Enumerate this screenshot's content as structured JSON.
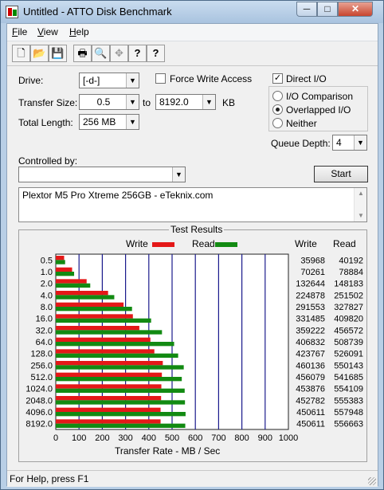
{
  "window": {
    "title": "Untitled - ATTO Disk Benchmark",
    "min_label": "─",
    "max_label": "□",
    "close_label": "✕"
  },
  "menu": [
    {
      "label": "File",
      "key": "F",
      "rest": "ile"
    },
    {
      "label": "View",
      "key": "V",
      "rest": "iew"
    },
    {
      "label": "Help",
      "key": "H",
      "rest": "elp"
    }
  ],
  "toolbar": {
    "icons": [
      "new-file-icon",
      "open-folder-icon",
      "save-icon",
      "print-icon",
      "print-preview-icon",
      "move-icon",
      "help-icon",
      "context-help-icon"
    ],
    "glyphs": [
      "🗋",
      "📂",
      "💾",
      "🖶",
      "🔍",
      "✥",
      "?",
      "?"
    ]
  },
  "settings": {
    "drive_label": "Drive:",
    "drive_value": "[-d-]",
    "transfer_size_label": "Transfer Size:",
    "transfer_from": "0.5",
    "to_label": "to",
    "transfer_to": "8192.0",
    "kb_label": "KB",
    "total_length_label": "Total Length:",
    "total_length_value": "256 MB",
    "force_write_label": "Force Write Access",
    "force_write_checked": false,
    "direct_io_label": "Direct I/O",
    "direct_io_checked": true,
    "io_comparison_label": "I/O Comparison",
    "overlapped_io_label": "Overlapped I/O",
    "neither_label": "Neither",
    "selected_mode": "Overlapped I/O",
    "queue_depth_label": "Queue Depth:",
    "queue_depth_value": "4",
    "controlled_by_label": "Controlled by:",
    "controlled_by_value": "",
    "start_label": "Start",
    "description": "Plextor M5 Pro Xtreme 256GB - eTeknix.com"
  },
  "results": {
    "title": "Test Results",
    "write_legend": "Write",
    "read_legend": "Read",
    "write_col": "Write",
    "read_col": "Read",
    "write_color": "#e41818",
    "read_color": "#128a12",
    "grid_color": "#1a1a8c",
    "xlabel": "Transfer Rate - MB / Sec"
  },
  "chart_data": {
    "type": "bar",
    "orientation": "horizontal",
    "categories": [
      "0.5",
      "1.0",
      "2.0",
      "4.0",
      "8.0",
      "16.0",
      "32.0",
      "64.0",
      "128.0",
      "256.0",
      "512.0",
      "1024.0",
      "2048.0",
      "4096.0",
      "8192.0"
    ],
    "series": [
      {
        "name": "Write",
        "values": [
          35968,
          70261,
          132644,
          224878,
          291553,
          331485,
          359222,
          406832,
          423767,
          460136,
          456079,
          453876,
          452782,
          450611,
          450611
        ]
      },
      {
        "name": "Read",
        "values": [
          40192,
          78884,
          148183,
          251502,
          327827,
          409820,
          456572,
          508739,
          526091,
          550143,
          541685,
          554109,
          555383,
          557948,
          556663
        ]
      }
    ],
    "value_unit_divisor": 1000,
    "xticks": [
      "0",
      "100",
      "200",
      "300",
      "400",
      "500",
      "600",
      "700",
      "800",
      "900",
      "1000"
    ],
    "xlim": [
      0,
      1000
    ],
    "xlabel": "Transfer Rate - MB / Sec"
  },
  "status": {
    "text": "For Help, press F1"
  }
}
